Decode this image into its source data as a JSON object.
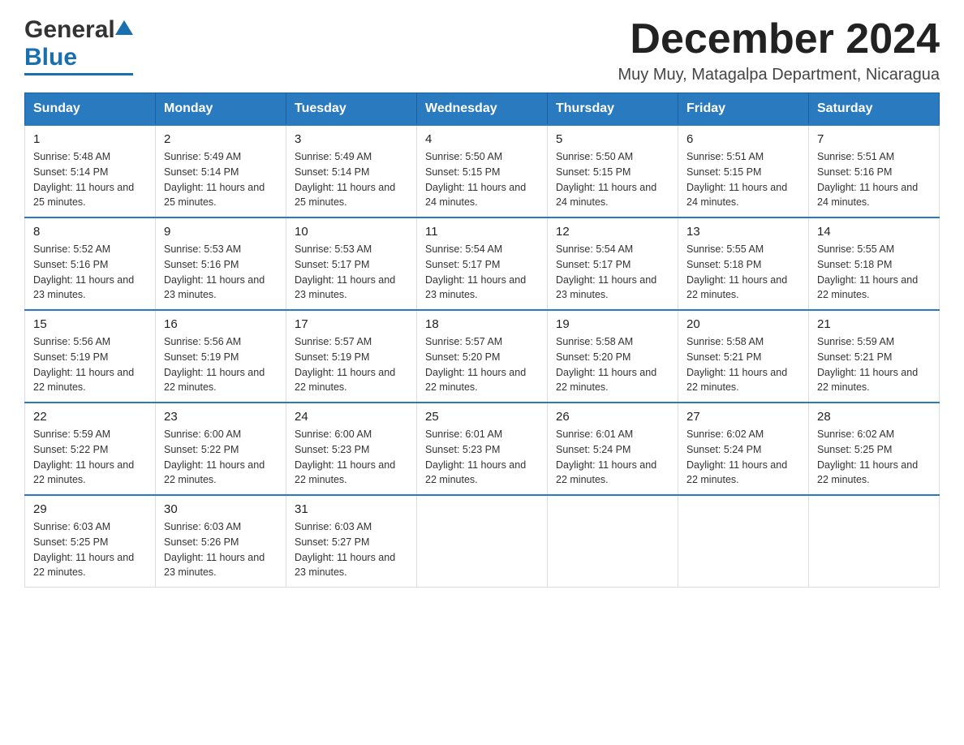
{
  "header": {
    "logo_general": "General",
    "logo_blue": "Blue",
    "month_title": "December 2024",
    "subtitle": "Muy Muy, Matagalpa Department, Nicaragua"
  },
  "days_of_week": [
    "Sunday",
    "Monday",
    "Tuesday",
    "Wednesday",
    "Thursday",
    "Friday",
    "Saturday"
  ],
  "weeks": [
    [
      {
        "day": "1",
        "sunrise": "5:48 AM",
        "sunset": "5:14 PM",
        "daylight": "11 hours and 25 minutes."
      },
      {
        "day": "2",
        "sunrise": "5:49 AM",
        "sunset": "5:14 PM",
        "daylight": "11 hours and 25 minutes."
      },
      {
        "day": "3",
        "sunrise": "5:49 AM",
        "sunset": "5:14 PM",
        "daylight": "11 hours and 25 minutes."
      },
      {
        "day": "4",
        "sunrise": "5:50 AM",
        "sunset": "5:15 PM",
        "daylight": "11 hours and 24 minutes."
      },
      {
        "day": "5",
        "sunrise": "5:50 AM",
        "sunset": "5:15 PM",
        "daylight": "11 hours and 24 minutes."
      },
      {
        "day": "6",
        "sunrise": "5:51 AM",
        "sunset": "5:15 PM",
        "daylight": "11 hours and 24 minutes."
      },
      {
        "day": "7",
        "sunrise": "5:51 AM",
        "sunset": "5:16 PM",
        "daylight": "11 hours and 24 minutes."
      }
    ],
    [
      {
        "day": "8",
        "sunrise": "5:52 AM",
        "sunset": "5:16 PM",
        "daylight": "11 hours and 23 minutes."
      },
      {
        "day": "9",
        "sunrise": "5:53 AM",
        "sunset": "5:16 PM",
        "daylight": "11 hours and 23 minutes."
      },
      {
        "day": "10",
        "sunrise": "5:53 AM",
        "sunset": "5:17 PM",
        "daylight": "11 hours and 23 minutes."
      },
      {
        "day": "11",
        "sunrise": "5:54 AM",
        "sunset": "5:17 PM",
        "daylight": "11 hours and 23 minutes."
      },
      {
        "day": "12",
        "sunrise": "5:54 AM",
        "sunset": "5:17 PM",
        "daylight": "11 hours and 23 minutes."
      },
      {
        "day": "13",
        "sunrise": "5:55 AM",
        "sunset": "5:18 PM",
        "daylight": "11 hours and 22 minutes."
      },
      {
        "day": "14",
        "sunrise": "5:55 AM",
        "sunset": "5:18 PM",
        "daylight": "11 hours and 22 minutes."
      }
    ],
    [
      {
        "day": "15",
        "sunrise": "5:56 AM",
        "sunset": "5:19 PM",
        "daylight": "11 hours and 22 minutes."
      },
      {
        "day": "16",
        "sunrise": "5:56 AM",
        "sunset": "5:19 PM",
        "daylight": "11 hours and 22 minutes."
      },
      {
        "day": "17",
        "sunrise": "5:57 AM",
        "sunset": "5:19 PM",
        "daylight": "11 hours and 22 minutes."
      },
      {
        "day": "18",
        "sunrise": "5:57 AM",
        "sunset": "5:20 PM",
        "daylight": "11 hours and 22 minutes."
      },
      {
        "day": "19",
        "sunrise": "5:58 AM",
        "sunset": "5:20 PM",
        "daylight": "11 hours and 22 minutes."
      },
      {
        "day": "20",
        "sunrise": "5:58 AM",
        "sunset": "5:21 PM",
        "daylight": "11 hours and 22 minutes."
      },
      {
        "day": "21",
        "sunrise": "5:59 AM",
        "sunset": "5:21 PM",
        "daylight": "11 hours and 22 minutes."
      }
    ],
    [
      {
        "day": "22",
        "sunrise": "5:59 AM",
        "sunset": "5:22 PM",
        "daylight": "11 hours and 22 minutes."
      },
      {
        "day": "23",
        "sunrise": "6:00 AM",
        "sunset": "5:22 PM",
        "daylight": "11 hours and 22 minutes."
      },
      {
        "day": "24",
        "sunrise": "6:00 AM",
        "sunset": "5:23 PM",
        "daylight": "11 hours and 22 minutes."
      },
      {
        "day": "25",
        "sunrise": "6:01 AM",
        "sunset": "5:23 PM",
        "daylight": "11 hours and 22 minutes."
      },
      {
        "day": "26",
        "sunrise": "6:01 AM",
        "sunset": "5:24 PM",
        "daylight": "11 hours and 22 minutes."
      },
      {
        "day": "27",
        "sunrise": "6:02 AM",
        "sunset": "5:24 PM",
        "daylight": "11 hours and 22 minutes."
      },
      {
        "day": "28",
        "sunrise": "6:02 AM",
        "sunset": "5:25 PM",
        "daylight": "11 hours and 22 minutes."
      }
    ],
    [
      {
        "day": "29",
        "sunrise": "6:03 AM",
        "sunset": "5:25 PM",
        "daylight": "11 hours and 22 minutes."
      },
      {
        "day": "30",
        "sunrise": "6:03 AM",
        "sunset": "5:26 PM",
        "daylight": "11 hours and 23 minutes."
      },
      {
        "day": "31",
        "sunrise": "6:03 AM",
        "sunset": "5:27 PM",
        "daylight": "11 hours and 23 minutes."
      },
      null,
      null,
      null,
      null
    ]
  ]
}
